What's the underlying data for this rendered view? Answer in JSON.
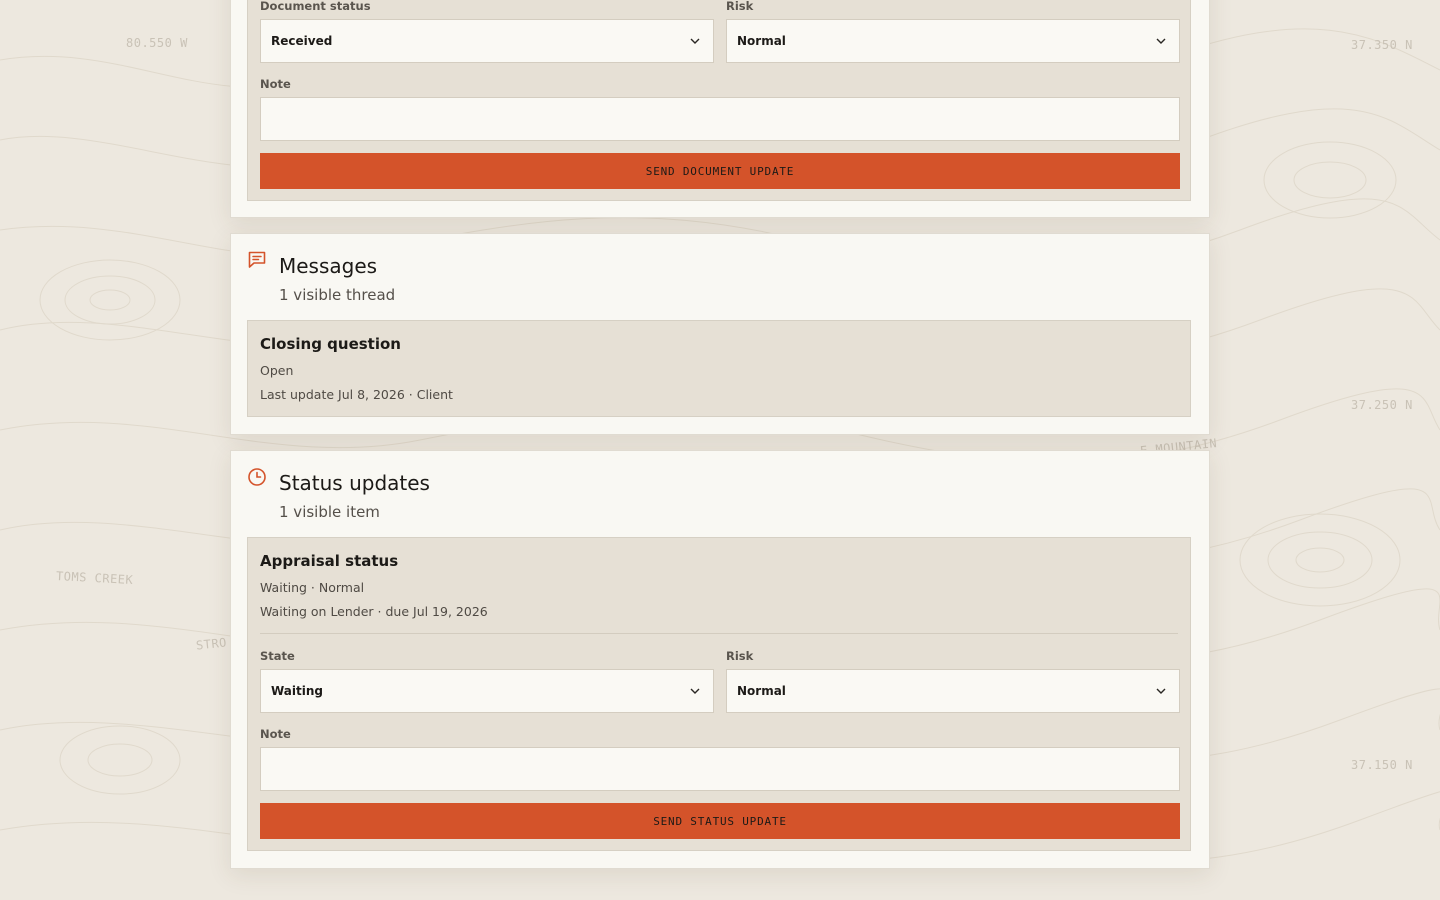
{
  "map_labels": {
    "lon_top_left": "80.550 W",
    "lat_1": "37.350 N",
    "lat_2": "37.250 N",
    "lat_3": "37.150 N",
    "place_1": "TOMS CREEK",
    "place_2": "STRO",
    "place_3": "E MOUNTAIN"
  },
  "document_update": {
    "status_label": "Document status",
    "status_value": "Received",
    "risk_label": "Risk",
    "risk_value": "Normal",
    "note_label": "Note",
    "note_value": "",
    "submit_label": "SEND DOCUMENT UPDATE"
  },
  "messages": {
    "title": "Messages",
    "subtitle": "1 visible thread",
    "threads": [
      {
        "title": "Closing question",
        "status": "Open",
        "meta": "Last update Jul 8, 2026 · Client"
      }
    ]
  },
  "status_updates": {
    "title": "Status updates",
    "subtitle": "1 visible item",
    "items": [
      {
        "title": "Appraisal status",
        "summary": "Waiting · Normal",
        "meta": "Waiting on Lender · due Jul 19, 2026",
        "state_label": "State",
        "state_value": "Waiting",
        "risk_label": "Risk",
        "risk_value": "Normal",
        "note_label": "Note",
        "note_value": "",
        "submit_label": "SEND STATUS UPDATE"
      }
    ]
  },
  "colors": {
    "accent": "#d4532a",
    "page_background": "#ede8df",
    "card_background": "#f9f8f3",
    "panel_background": "#e6e0d5"
  },
  "icons": {
    "messages": "chat-bubble-icon",
    "status_updates": "clock-icon",
    "dropdown": "chevron-down-icon"
  }
}
